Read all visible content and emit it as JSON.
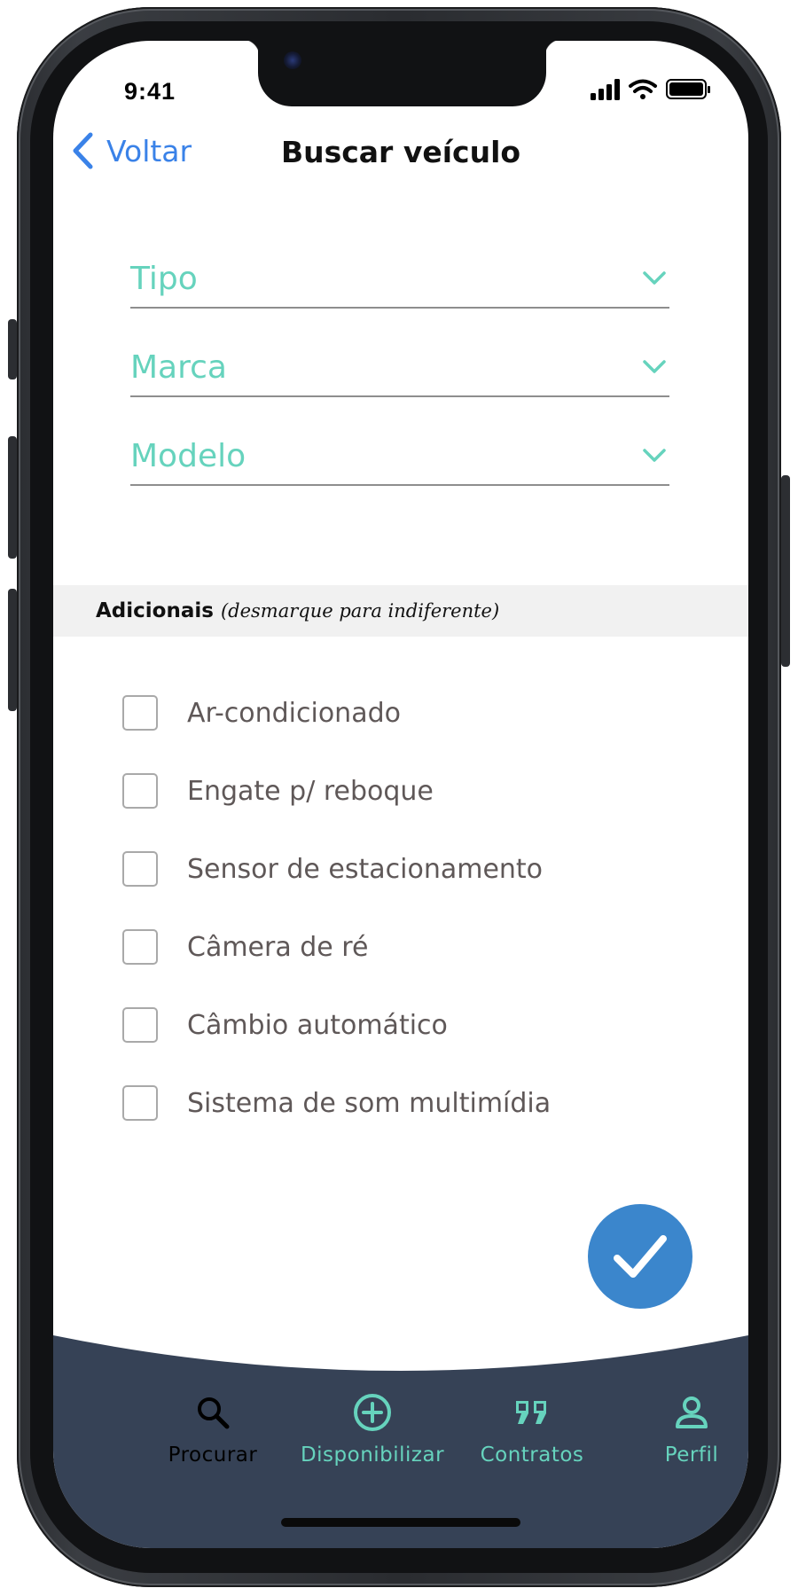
{
  "status_bar": {
    "time": "9:41"
  },
  "header": {
    "back_label": "Voltar",
    "title": "Buscar veículo"
  },
  "filters": [
    {
      "label": "Tipo"
    },
    {
      "label": "Marca"
    },
    {
      "label": "Modelo"
    }
  ],
  "additional": {
    "title": "Adicionais",
    "hint": "(desmarque para indiferente)",
    "options": [
      {
        "label": "Ar-condicionado",
        "checked": false
      },
      {
        "label": "Engate p/ reboque",
        "checked": false
      },
      {
        "label": "Sensor de estacionamento",
        "checked": false
      },
      {
        "label": "Câmera de ré",
        "checked": false
      },
      {
        "label": "Câmbio automático",
        "checked": false
      },
      {
        "label": "Sistema de som multimídia",
        "checked": false
      }
    ]
  },
  "fab": {
    "icon": "check-icon"
  },
  "bottom_nav": {
    "items": [
      {
        "label": "Procurar",
        "icon": "search-icon",
        "active": true
      },
      {
        "label": "Disponibilizar",
        "icon": "plus-circle-icon",
        "active": false
      },
      {
        "label": "Contratos",
        "icon": "quote-icon",
        "active": false
      },
      {
        "label": "Perfil",
        "icon": "user-icon",
        "active": false
      }
    ]
  },
  "colors": {
    "accent_teal": "#66d3bd",
    "link_blue": "#3a82e8",
    "fab_blue": "#3b86cc",
    "nav_background": "#364256",
    "nav_active": "#000000"
  }
}
